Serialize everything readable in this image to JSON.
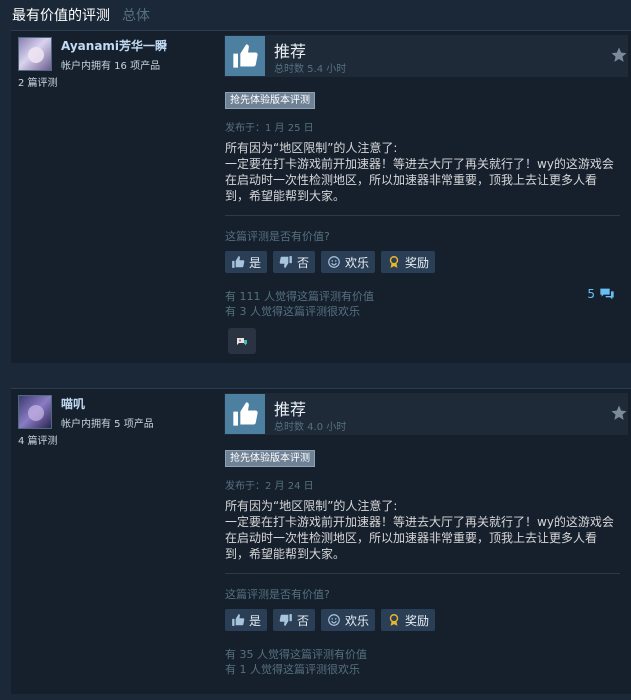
{
  "header": {
    "title": "最有价值的评测",
    "subtitle": "总体"
  },
  "reviews": [
    {
      "username": "Ayanami芳华一瞬",
      "owned": "帐户内拥有 16 项产品",
      "review_count": "2 篇评测",
      "verdict": "推荐",
      "hours": "总时数 5.4 小时",
      "tag": "抢先体验版本评测",
      "posted": "发布于：1 月 25 日",
      "content": [
        "所有因为“地区限制”的人注意了:",
        "一定要在打卡游戏前开加速器！等进去大厅了再关就行了！wy的这游戏会在启动时一次性检测地区，所以加速器非常重要，顶我上去让更多人看到，希望能帮到大家。"
      ],
      "helpful_question": "这篇评测是否有价值?",
      "buttons": {
        "yes": "是",
        "no": "否",
        "funny": "欢乐",
        "award": "奖励"
      },
      "helpful_stat": "有 111 人觉得这篇评测有价值",
      "funny_stat": "有 3 人觉得这篇评测很欢乐",
      "comment_count": "5"
    },
    {
      "username": "喵叽",
      "owned": "帐户内拥有 5 项产品",
      "review_count": "4 篇评测",
      "verdict": "推荐",
      "hours": "总时数 4.0 小时",
      "tag": "抢先体验版本评测",
      "posted": "发布于：2 月 24 日",
      "content": [
        "所有因为“地区限制”的人注意了:",
        "一定要在打卡游戏前开加速器！等进去大厅了再关就行了！wy的这游戏会在启动时一次性检测地区，所以加速器非常重要，顶我上去让更多人看到，希望能帮到大家。"
      ],
      "helpful_question": "这篇评测是否有价值?",
      "buttons": {
        "yes": "是",
        "no": "否",
        "funny": "欢乐",
        "award": "奖励"
      },
      "helpful_stat": "有 35 人觉得这篇评测有价值",
      "funny_stat": "有 1 人觉得这篇评测很欢乐"
    }
  ],
  "icons": {
    "thumbs_up": "thumbs-up-icon",
    "thumbs_down": "thumbs-down-icon",
    "funny": "smiley-icon",
    "award": "award-ribbon-icon",
    "star": "star-icon",
    "comment": "comment-bubble-icon"
  },
  "colors": {
    "background": "#1b2838",
    "panel": "#16202d",
    "thumb_box": "#4d7fa1",
    "link": "#66c0f4",
    "award_gold": "#e8b630"
  }
}
